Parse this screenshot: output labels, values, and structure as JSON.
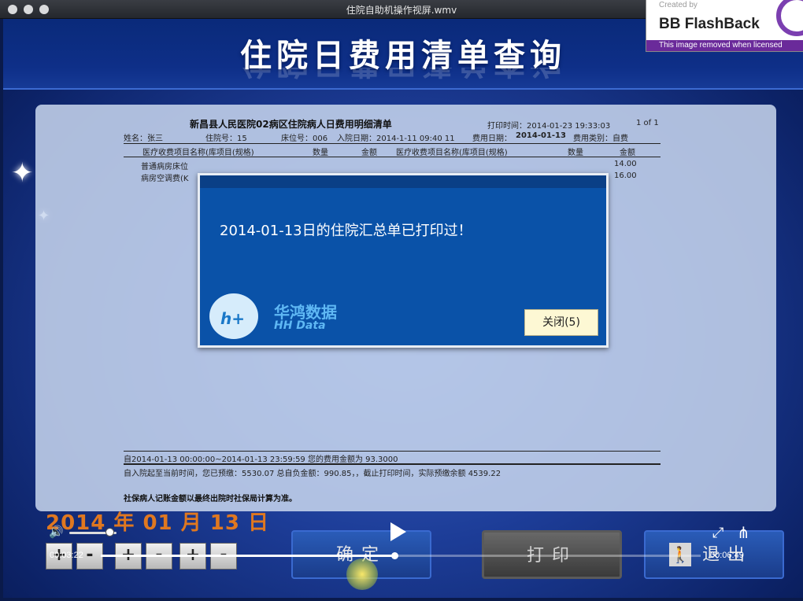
{
  "window": {
    "title": "住院自助机操作视屏.wmv"
  },
  "watermark": {
    "created": "Created by",
    "brand": "BB FlashBack",
    "removed": "This image removed when licensed"
  },
  "page": {
    "title": "住院日费用清单查询"
  },
  "bill": {
    "title": "新昌县人民医院02病区住院病人日费用明细清单",
    "print_time": "打印时间：2014-01-23 19:33:03",
    "page_info": "1 of 1",
    "name": "姓名：张三",
    "inpatient_no": "住院号：15",
    "bed_no": "床位号：006",
    "admission_date": "入院日期：2014-1-11 09:40 11",
    "fee_date_label": "费用日期：",
    "fee_date": "2014-01-13",
    "fee_type": "费用类别：自费",
    "col_item": "医疗收费项目名称(库项目(规格)",
    "col_qty": "数量",
    "col_amount": "金额",
    "col_item_2": "医疗收费项目名称(库项目(规格)",
    "col_qty_2": "数量",
    "col_amount_2": "金额",
    "row1_name": "普通病房床位",
    "row1_amount": "14.00",
    "row2_name": "病房空调费(K",
    "row2_amount": "16.00",
    "summary1": "自2014-01-13 00:00:00~2014-01-13 23:59:59 您的费用金额为 93.3000",
    "summary2": "自入院起至当前时间，您已预缴：5530.07        总自负金额：990.85，，截止打印时间，实际预缴余额  4539.22",
    "note": "社保病人记账金额以最终出院时社保局计算为准。"
  },
  "dialog": {
    "message": "2014-01-13日的住院汇总单已打印过！",
    "logo_cn": "华鸿数据",
    "logo_en": "HH Data",
    "logo_mark": "h+",
    "close_label": "关闭(5)"
  },
  "kiosk": {
    "date_display": "2014 年 01 月 13 日",
    "steppers": [
      "+",
      "-",
      "+",
      "-",
      "+",
      "-"
    ],
    "confirm_label": "确定",
    "print_label": "打印",
    "exit_label": "退出"
  },
  "player": {
    "current_time": "00:03:22",
    "total_time": "00:06:49",
    "progress": 0.49,
    "volume": 0.85
  }
}
